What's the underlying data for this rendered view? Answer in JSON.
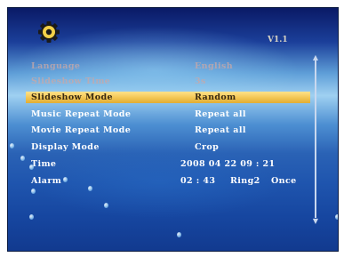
{
  "header": {
    "settings_icon": "gear-icon",
    "version": "V1.1"
  },
  "menu": {
    "items": [
      {
        "label": "Language",
        "value": "English"
      },
      {
        "label": "Slideshow Time",
        "value": "3s"
      },
      {
        "label": "Slideshow Mode",
        "value": "Random"
      },
      {
        "label": "Music Repeat Mode",
        "value": "Repeat all"
      },
      {
        "label": "Movie Repeat Mode",
        "value": "Repeat all"
      },
      {
        "label": "Display Mode",
        "value": "Crop"
      },
      {
        "label": "Time",
        "value": "2008  04  22  09 : 21"
      },
      {
        "label": "Alarm",
        "value": "02 : 43",
        "value2": "Ring2",
        "value3": "Once"
      }
    ],
    "selected_index": 2
  },
  "scrollbar": {
    "up_icon": "up-arrow-icon",
    "down_icon": "down-arrow-icon"
  },
  "colors": {
    "highlight": "#f2c552",
    "background_top": "#0a1a66",
    "background_bottom": "#123a8f"
  }
}
